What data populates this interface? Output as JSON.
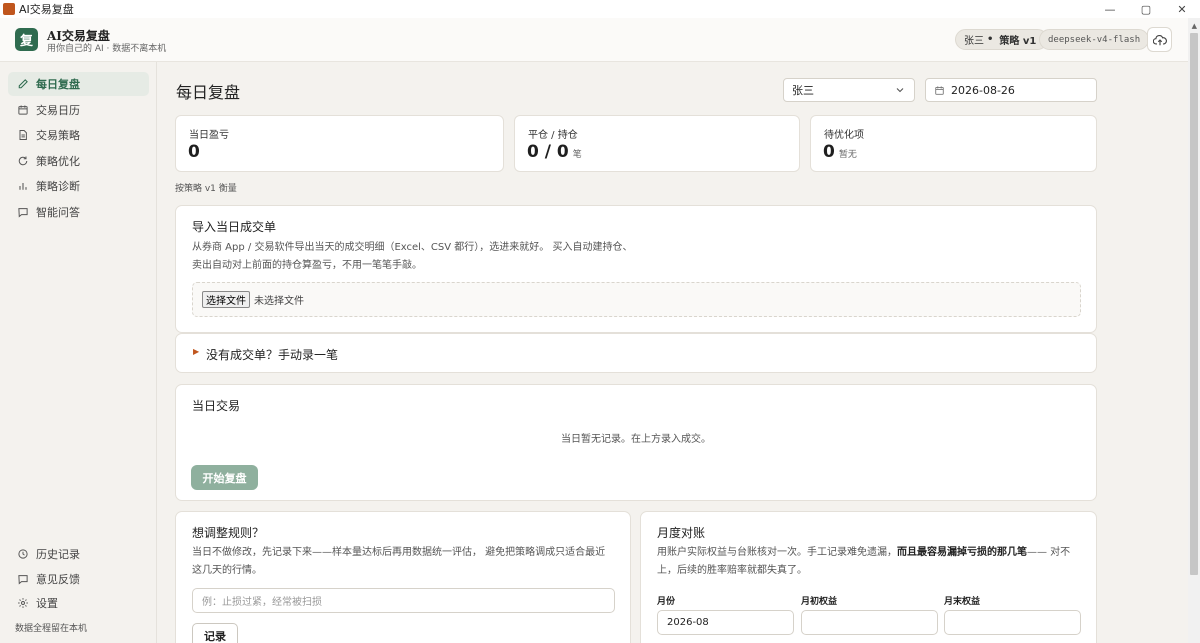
{
  "window": {
    "title": "AI交易复盘",
    "controls": [
      "—",
      "▢",
      "✕"
    ]
  },
  "header": {
    "logo_char": "复",
    "app_name": "AI交易复盘",
    "tagline": "用你自己的 AI · 数据不离本机",
    "user_pill": {
      "user": "张三",
      "sep": "•",
      "strategy": "策略 v1"
    },
    "model_pill": "deepseek-v4-flash"
  },
  "sidebar": {
    "items": [
      {
        "label": "每日复盘",
        "icon": "pencil-icon"
      },
      {
        "label": "交易日历",
        "icon": "calendar-icon"
      },
      {
        "label": "交易策略",
        "icon": "document-icon"
      },
      {
        "label": "策略优化",
        "icon": "refresh-icon"
      },
      {
        "label": "策略诊断",
        "icon": "bar-chart-icon"
      },
      {
        "label": "智能问答",
        "icon": "chat-icon"
      }
    ],
    "bottom": [
      {
        "label": "历史记录",
        "icon": "clock-icon"
      },
      {
        "label": "意见反馈",
        "icon": "feedback-icon"
      },
      {
        "label": "设置",
        "icon": "gear-icon"
      }
    ],
    "footer": "数据全程留在本机"
  },
  "main": {
    "title": "每日复盘",
    "user_select": "张三",
    "date": "2026-08-26",
    "stats": [
      {
        "label": "当日盈亏",
        "value": "0",
        "unit": ""
      },
      {
        "label": "平仓 / 持仓",
        "value": "0 / 0",
        "unit": "笔"
      },
      {
        "label": "待优化项",
        "value": "0",
        "unit": "暂无"
      }
    ],
    "strategy_note": "按策略 v1 衡量",
    "import": {
      "title": "导入当日成交单",
      "desc_line1": "从券商 App / 交易软件导出当天的成交明细（Excel、CSV 都行），选进来就好。 买入自动建持仓、",
      "desc_line2": "卖出自动对上前面的持仓算盈亏，不用一笔笔手敲。",
      "file_button": "选择文件",
      "file_status": "未选择文件"
    },
    "manual": {
      "title": "没有成交单？手动录一笔"
    },
    "trades": {
      "title": "当日交易",
      "empty": "当日暂无记录。在上方录入成交。",
      "start_button": "开始复盘"
    },
    "rules": {
      "title": "想调整规则？",
      "desc_line1": "当日不做修改，先记录下来——样本量达标后再用数据统一评估， 避免把策略调成只适合最近",
      "desc_line2": "这几天的行情。",
      "placeholder": "例：止损过紧，经常被扫损",
      "record_button": "记录"
    },
    "monthly": {
      "title": "月度对账",
      "desc_line1_a": "用账户实际权益与台账核对一次。手工记录难免遗漏，",
      "desc_line1_b": "而且最容易漏掉亏损的那几笔",
      "desc_line1_c": "—— 对不",
      "desc_line2": "上，后续的胜率赔率就都失真了。",
      "fields": [
        {
          "label": "月份",
          "value": "2026-08"
        },
        {
          "label": "月初权益",
          "value": ""
        },
        {
          "label": "月末权益",
          "value": ""
        }
      ]
    }
  },
  "colors": {
    "accent": "#2f6b4f",
    "brand": "#c0561e",
    "background": "#f4f2ee",
    "button_disabled": "#8fb09e"
  }
}
